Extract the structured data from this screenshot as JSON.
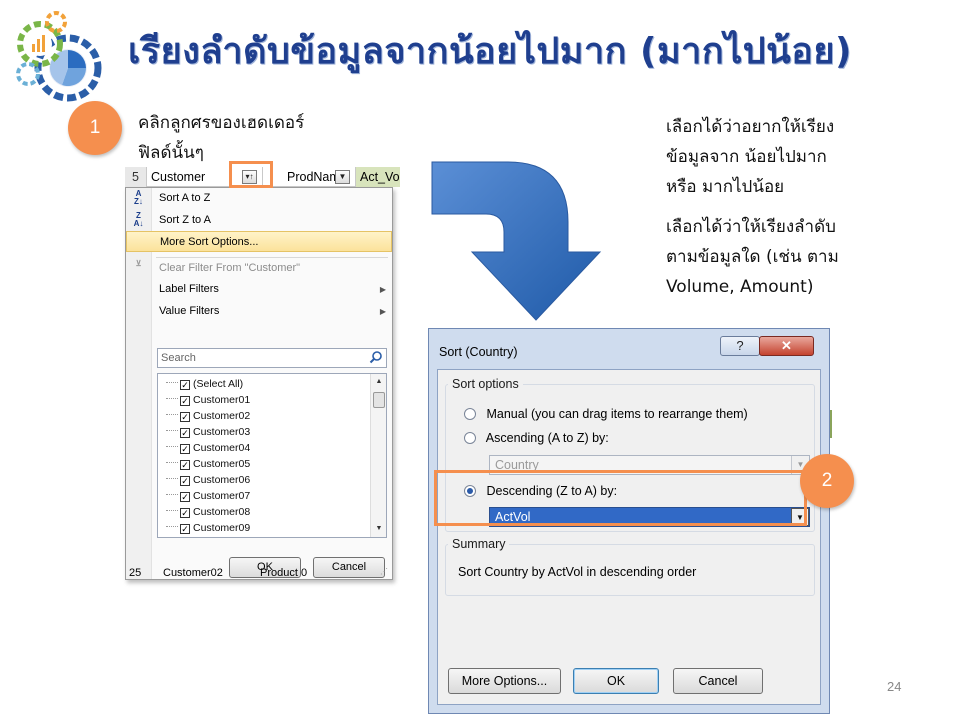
{
  "slide": {
    "title": "เรียงลำดับข้อมูลจากน้อยไปมาก (มากไปน้อย)",
    "page_number": "24",
    "title_color": "#1F3F8F",
    "accent_color": "#F58F4E"
  },
  "steps": {
    "step1_number": "1",
    "step1_text_line1": "คลิกลูกศรของเฮดเดอร์",
    "step1_text_line2": "ฟิลด์นั้นๆ",
    "step2_number": "2"
  },
  "notes": {
    "note1_line1": "เลือกได้ว่าอยากให้เรียง",
    "note1_line2": "ข้อมูลจาก น้อยไปมาก",
    "note1_line3": "หรือ มากไปน้อย",
    "note2_line1": "เลือกได้ว่าให้เรียงลำดับ",
    "note2_line2": "ตามข้อมูลใด (เช่น ตาม",
    "note2_line3": "Volume, Amount)"
  },
  "excel_menu": {
    "header_rownum": "5",
    "header_customer": "Customer",
    "header_prodname": "ProdName",
    "header_actvol": "Act_Vo",
    "items": {
      "sort_a_to_z": "Sort A to Z",
      "sort_z_to_a": "Sort Z to A",
      "more_sort_options": "More Sort Options...",
      "clear_filter": "Clear Filter From \"Customer\"",
      "label_filters": "Label Filters",
      "value_filters": "Value Filters"
    },
    "search_placeholder": "Search",
    "list": [
      {
        "label": "(Select All)",
        "checked": true
      },
      {
        "label": "Customer01",
        "checked": true
      },
      {
        "label": "Customer02",
        "checked": true
      },
      {
        "label": "Customer03",
        "checked": true
      },
      {
        "label": "Customer04",
        "checked": true
      },
      {
        "label": "Customer05",
        "checked": true
      },
      {
        "label": "Customer06",
        "checked": true
      },
      {
        "label": "Customer07",
        "checked": true
      },
      {
        "label": "Customer08",
        "checked": true
      },
      {
        "label": "Customer09",
        "checked": true
      }
    ],
    "ok_label": "OK",
    "cancel_label": "Cancel",
    "bottom_row_num": "25",
    "bottom_row_customer": "Customer02",
    "bottom_row_product": "Product 0"
  },
  "sort_dialog": {
    "title": "Sort (Country)",
    "help_label": "?",
    "close_label": "✕",
    "sort_options_label": "Sort options",
    "manual_label": "Manual (you can drag items to rearrange them)",
    "ascending_label": "Ascending (A to Z) by:",
    "ascending_value": "Country",
    "descending_label": "Descending (Z to A) by:",
    "descending_value": "ActVol",
    "selected_option": "descending",
    "summary_label": "Summary",
    "summary_text": "Sort Country by ActVol in descending order",
    "more_options_label": "More Options...",
    "ok_label": "OK",
    "cancel_label": "Cancel"
  }
}
